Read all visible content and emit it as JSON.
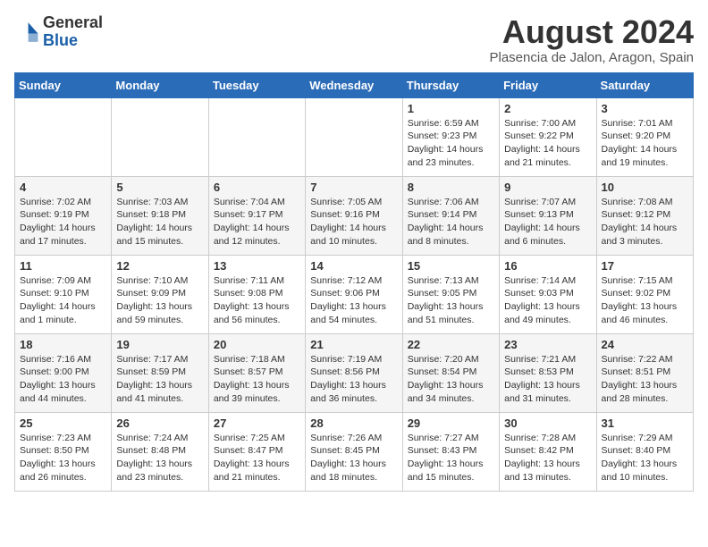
{
  "header": {
    "logo_general": "General",
    "logo_blue": "Blue",
    "title": "August 2024",
    "subtitle": "Plasencia de Jalon, Aragon, Spain"
  },
  "days_of_week": [
    "Sunday",
    "Monday",
    "Tuesday",
    "Wednesday",
    "Thursday",
    "Friday",
    "Saturday"
  ],
  "weeks": [
    [
      {
        "day": "",
        "content": ""
      },
      {
        "day": "",
        "content": ""
      },
      {
        "day": "",
        "content": ""
      },
      {
        "day": "",
        "content": ""
      },
      {
        "day": "1",
        "content": "Sunrise: 6:59 AM\nSunset: 9:23 PM\nDaylight: 14 hours\nand 23 minutes."
      },
      {
        "day": "2",
        "content": "Sunrise: 7:00 AM\nSunset: 9:22 PM\nDaylight: 14 hours\nand 21 minutes."
      },
      {
        "day": "3",
        "content": "Sunrise: 7:01 AM\nSunset: 9:20 PM\nDaylight: 14 hours\nand 19 minutes."
      }
    ],
    [
      {
        "day": "4",
        "content": "Sunrise: 7:02 AM\nSunset: 9:19 PM\nDaylight: 14 hours\nand 17 minutes."
      },
      {
        "day": "5",
        "content": "Sunrise: 7:03 AM\nSunset: 9:18 PM\nDaylight: 14 hours\nand 15 minutes."
      },
      {
        "day": "6",
        "content": "Sunrise: 7:04 AM\nSunset: 9:17 PM\nDaylight: 14 hours\nand 12 minutes."
      },
      {
        "day": "7",
        "content": "Sunrise: 7:05 AM\nSunset: 9:16 PM\nDaylight: 14 hours\nand 10 minutes."
      },
      {
        "day": "8",
        "content": "Sunrise: 7:06 AM\nSunset: 9:14 PM\nDaylight: 14 hours\nand 8 minutes."
      },
      {
        "day": "9",
        "content": "Sunrise: 7:07 AM\nSunset: 9:13 PM\nDaylight: 14 hours\nand 6 minutes."
      },
      {
        "day": "10",
        "content": "Sunrise: 7:08 AM\nSunset: 9:12 PM\nDaylight: 14 hours\nand 3 minutes."
      }
    ],
    [
      {
        "day": "11",
        "content": "Sunrise: 7:09 AM\nSunset: 9:10 PM\nDaylight: 14 hours\nand 1 minute."
      },
      {
        "day": "12",
        "content": "Sunrise: 7:10 AM\nSunset: 9:09 PM\nDaylight: 13 hours\nand 59 minutes."
      },
      {
        "day": "13",
        "content": "Sunrise: 7:11 AM\nSunset: 9:08 PM\nDaylight: 13 hours\nand 56 minutes."
      },
      {
        "day": "14",
        "content": "Sunrise: 7:12 AM\nSunset: 9:06 PM\nDaylight: 13 hours\nand 54 minutes."
      },
      {
        "day": "15",
        "content": "Sunrise: 7:13 AM\nSunset: 9:05 PM\nDaylight: 13 hours\nand 51 minutes."
      },
      {
        "day": "16",
        "content": "Sunrise: 7:14 AM\nSunset: 9:03 PM\nDaylight: 13 hours\nand 49 minutes."
      },
      {
        "day": "17",
        "content": "Sunrise: 7:15 AM\nSunset: 9:02 PM\nDaylight: 13 hours\nand 46 minutes."
      }
    ],
    [
      {
        "day": "18",
        "content": "Sunrise: 7:16 AM\nSunset: 9:00 PM\nDaylight: 13 hours\nand 44 minutes."
      },
      {
        "day": "19",
        "content": "Sunrise: 7:17 AM\nSunset: 8:59 PM\nDaylight: 13 hours\nand 41 minutes."
      },
      {
        "day": "20",
        "content": "Sunrise: 7:18 AM\nSunset: 8:57 PM\nDaylight: 13 hours\nand 39 minutes."
      },
      {
        "day": "21",
        "content": "Sunrise: 7:19 AM\nSunset: 8:56 PM\nDaylight: 13 hours\nand 36 minutes."
      },
      {
        "day": "22",
        "content": "Sunrise: 7:20 AM\nSunset: 8:54 PM\nDaylight: 13 hours\nand 34 minutes."
      },
      {
        "day": "23",
        "content": "Sunrise: 7:21 AM\nSunset: 8:53 PM\nDaylight: 13 hours\nand 31 minutes."
      },
      {
        "day": "24",
        "content": "Sunrise: 7:22 AM\nSunset: 8:51 PM\nDaylight: 13 hours\nand 28 minutes."
      }
    ],
    [
      {
        "day": "25",
        "content": "Sunrise: 7:23 AM\nSunset: 8:50 PM\nDaylight: 13 hours\nand 26 minutes."
      },
      {
        "day": "26",
        "content": "Sunrise: 7:24 AM\nSunset: 8:48 PM\nDaylight: 13 hours\nand 23 minutes."
      },
      {
        "day": "27",
        "content": "Sunrise: 7:25 AM\nSunset: 8:47 PM\nDaylight: 13 hours\nand 21 minutes."
      },
      {
        "day": "28",
        "content": "Sunrise: 7:26 AM\nSunset: 8:45 PM\nDaylight: 13 hours\nand 18 minutes."
      },
      {
        "day": "29",
        "content": "Sunrise: 7:27 AM\nSunset: 8:43 PM\nDaylight: 13 hours\nand 15 minutes."
      },
      {
        "day": "30",
        "content": "Sunrise: 7:28 AM\nSunset: 8:42 PM\nDaylight: 13 hours\nand 13 minutes."
      },
      {
        "day": "31",
        "content": "Sunrise: 7:29 AM\nSunset: 8:40 PM\nDaylight: 13 hours\nand 10 minutes."
      }
    ]
  ]
}
